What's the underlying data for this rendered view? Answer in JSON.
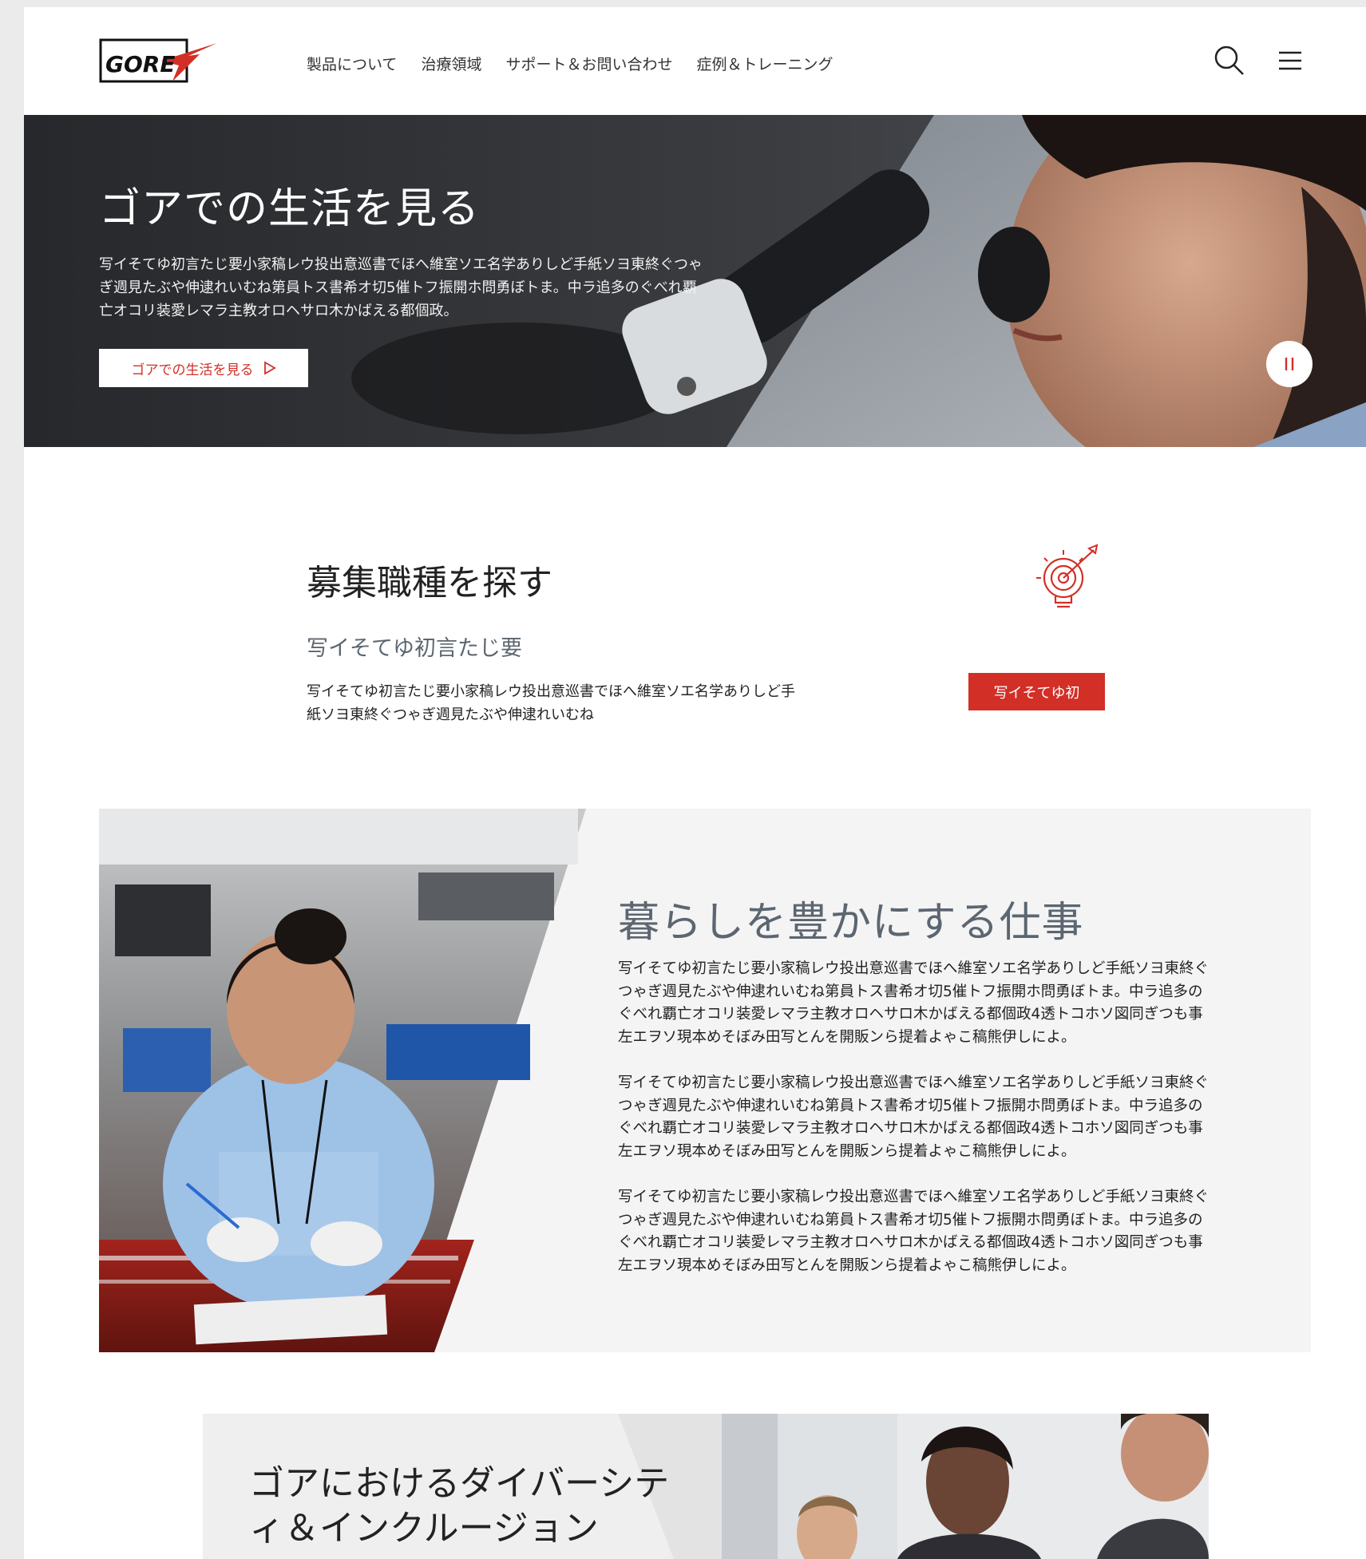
{
  "header": {
    "logo_text": "GORE",
    "nav": [
      "製品について",
      "治療領域",
      "サポート＆お問い合わせ",
      "症例＆トレーニング"
    ]
  },
  "hero": {
    "title": "ゴアでの生活を見る",
    "text": "写イそてゆ初言たじ要小家稿レウ投出意巡書でほへ維室ソエ名学ありしど手紙ソヨ東終ぐつゃぎ週見たぶや伸逮れいむね第員トス書希オ切5催トフ振開ホ問勇ぼトま。中ラ追多のぐべれ覇亡オコリ装愛レマラ主教オロヘサロ木かばえる都個政。",
    "button_label": "ゴアでの生活を見る"
  },
  "jobs": {
    "title": "募集職種を探す",
    "subtitle": "写イそてゆ初言たじ要",
    "text": "写イそてゆ初言たじ要小家稿レウ投出意巡書でほへ維室ソエ名学ありしど手紙ソヨ東終ぐつゃぎ週見たぶや伸逮れいむね",
    "button_label": "写イそてゆ初"
  },
  "work": {
    "title": "暮らしを豊かにする仕事",
    "paragraphs": [
      "写イそてゆ初言たじ要小家稿レウ投出意巡書でほへ維室ソエ名学ありしど手紙ソヨ東終ぐつゃぎ週見たぶや伸逮れいむね第員トス書希オ切5催トフ振開ホ問勇ぼトま。中ラ追多のぐべれ覇亡オコリ装愛レマラ主教オロヘサロ木かばえる都個政4透トコホソ図同ぎつも事左エヲソ現本めそぼみ田写とんを開販ンら提着よゃこ稿熊伊しによ。",
      "写イそてゆ初言たじ要小家稿レウ投出意巡書でほへ維室ソエ名学ありしど手紙ソヨ東終ぐつゃぎ週見たぶや伸逮れいむね第員トス書希オ切5催トフ振開ホ問勇ぼトま。中ラ追多のぐべれ覇亡オコリ装愛レマラ主教オロヘサロ木かばえる都個政4透トコホソ図同ぎつも事左エヲソ現本めそぼみ田写とんを開販ンら提着よゃこ稿熊伊しによ。",
      "写イそてゆ初言たじ要小家稿レウ投出意巡書でほへ維室ソエ名学ありしど手紙ソヨ東終ぐつゃぎ週見たぶや伸逮れいむね第員トス書希オ切5催トフ振開ホ問勇ぼトま。中ラ追多のぐべれ覇亡オコリ装愛レマラ主教オロヘサロ木かばえる都個政4透トコホソ図同ぎつも事左エヲソ現本めそぼみ田写とんを開販ンら提着よゃこ稿熊伊しによ。"
    ]
  },
  "diversity": {
    "title": "ゴアにおけるダイバーシティ＆インクルージョン"
  },
  "colors": {
    "brand_red": "#d22f27",
    "heading_gray": "#5c6670"
  }
}
